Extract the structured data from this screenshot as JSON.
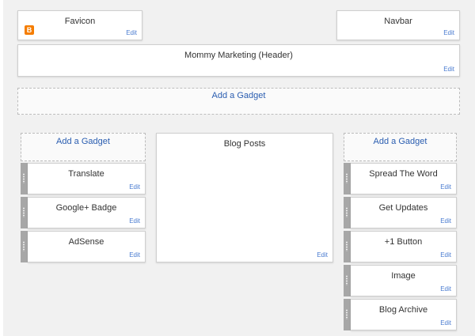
{
  "top": {
    "favicon": {
      "title": "Favicon",
      "edit": "Edit",
      "icon": "blogger-icon",
      "icon_glyph": "B",
      "icon_color": "#f57d00"
    },
    "navbar": {
      "title": "Navbar",
      "edit": "Edit"
    },
    "header": {
      "title": "Mommy Marketing (Header)",
      "edit": "Edit"
    },
    "add_gadget_wide": "Add a Gadget"
  },
  "left_sidebar": {
    "add_gadget": "Add a Gadget",
    "gadgets": [
      {
        "title": "Translate",
        "edit": "Edit"
      },
      {
        "title": "Google+ Badge",
        "edit": "Edit"
      },
      {
        "title": "AdSense",
        "edit": "Edit"
      }
    ]
  },
  "main": {
    "title": "Blog Posts",
    "edit": "Edit"
  },
  "right_sidebar": {
    "add_gadget": "Add a Gadget",
    "gadgets": [
      {
        "title": "Spread The Word",
        "edit": "Edit"
      },
      {
        "title": "Get Updates",
        "edit": "Edit"
      },
      {
        "title": "+1 Button",
        "edit": "Edit"
      },
      {
        "title": "Image",
        "edit": "Edit"
      },
      {
        "title": "Blog Archive",
        "edit": "Edit"
      }
    ]
  },
  "colors": {
    "link": "#2a5db0",
    "edit": "#4a7bd0",
    "handle": "#a7a7a7",
    "background": "#f1f1f1"
  }
}
